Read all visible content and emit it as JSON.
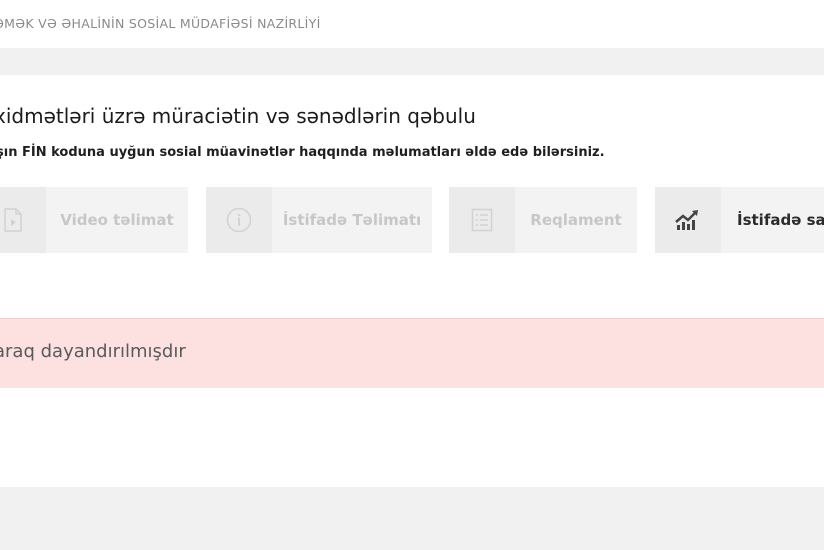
{
  "header": {
    "ministry": "ƏMƏK VƏ ƏHALİNİN SOSİAL MÜDAFİƏSİ NAZİRLİYİ"
  },
  "page": {
    "title": "xidmətləri üzrə müraciətin və sənədlərin qəbulu",
    "subtitle": "şın FİN koduna uyğun sosial müavinətlər haqqında məlumatları əldə edə bilərsiniz."
  },
  "buttons": {
    "video": {
      "label": "Video təlimat",
      "icon": "video-file-icon"
    },
    "guide": {
      "label": "İstifadə Təlimatı",
      "icon": "info-icon"
    },
    "regulation": {
      "label": "Reqlament",
      "icon": "document-list-icon"
    },
    "stats": {
      "label": "İstifadə sayı",
      "icon": "trend-chart-icon"
    }
  },
  "alert": {
    "text": "araq dayandırılmışdır"
  },
  "colors": {
    "background": "#f1f1f1",
    "alert_background": "#fde1e1",
    "disabled_text": "#c7c7c7"
  }
}
